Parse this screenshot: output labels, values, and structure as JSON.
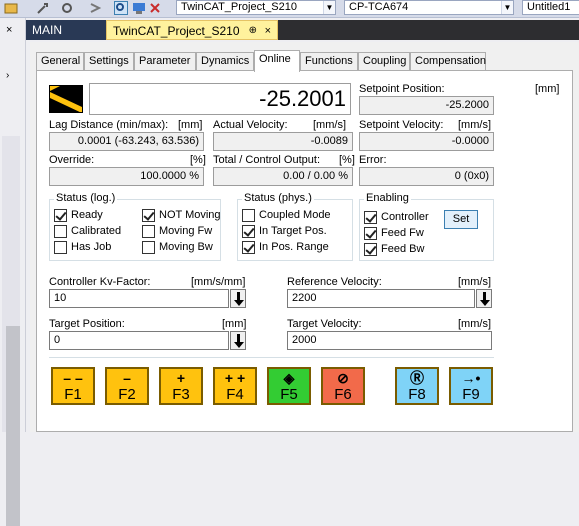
{
  "toolbar": {
    "combo1": "TwinCAT_Project_S210",
    "combo2": "CP-TCA674",
    "combo3": "Untitled1"
  },
  "doc_tabs": {
    "main": "MAIN",
    "active": "TwinCAT_Project_S210",
    "pin": "⊕",
    "close": "×"
  },
  "tabs": [
    "General",
    "Settings",
    "Parameter",
    "Dynamics",
    "Online",
    "Functions",
    "Coupling",
    "Compensation"
  ],
  "online": {
    "actual_position": "-25.2001",
    "setpoint_position_label": "Setpoint Position:",
    "setpoint_position_unit": "[mm]",
    "setpoint_position": "-25.2000",
    "lag_label": "Lag Distance (min/max):",
    "lag_unit": "[mm]",
    "lag_value": "0.0001  (-63.243, 63.536)",
    "actual_velocity_label": "Actual Velocity:",
    "actual_velocity_unit": "[mm/s]",
    "actual_velocity": "-0.0089",
    "setpoint_velocity_label": "Setpoint Velocity:",
    "setpoint_velocity_unit": "[mm/s]",
    "setpoint_velocity": "-0.0000",
    "override_label": "Override:",
    "override_unit": "[%]",
    "override": "100.0000 %",
    "total_output_label": "Total / Control Output:",
    "total_output_unit": "[%]",
    "total_output": "0.00 / 0.00 %",
    "error_label": "Error:",
    "error": "0 (0x0)"
  },
  "status_log": {
    "title": "Status (log.)",
    "items": [
      {
        "label": "Ready",
        "checked": true
      },
      {
        "label": "Calibrated",
        "checked": false
      },
      {
        "label": "Has Job",
        "checked": false
      },
      {
        "label": "NOT Moving",
        "checked": true
      },
      {
        "label": "Moving Fw",
        "checked": false
      },
      {
        "label": "Moving Bw",
        "checked": false
      }
    ]
  },
  "status_phys": {
    "title": "Status (phys.)",
    "items": [
      {
        "label": "Coupled Mode",
        "checked": false
      },
      {
        "label": "In Target Pos.",
        "checked": true
      },
      {
        "label": "In Pos. Range",
        "checked": true
      }
    ]
  },
  "enabling": {
    "title": "Enabling",
    "items": [
      {
        "label": "Controller",
        "checked": true
      },
      {
        "label": "Feed Fw",
        "checked": true
      },
      {
        "label": "Feed Bw",
        "checked": true
      }
    ],
    "set_label": "Set"
  },
  "controls": {
    "kv_label": "Controller Kv-Factor:",
    "kv_unit": "[mm/s/mm]",
    "kv_value": "10",
    "ref_vel_label": "Reference Velocity:",
    "ref_vel_unit": "[mm/s]",
    "ref_vel_value": "2200",
    "target_pos_label": "Target Position:",
    "target_pos_unit": "[mm]",
    "target_pos_value": "0",
    "target_vel_label": "Target Velocity:",
    "target_vel_unit": "[mm/s]",
    "target_vel_value": "2000"
  },
  "fkeys": [
    {
      "symbol": "– –",
      "key": "F1",
      "color": "#ffc20e"
    },
    {
      "symbol": "–",
      "key": "F2",
      "color": "#ffc20e"
    },
    {
      "symbol": "+",
      "key": "F3",
      "color": "#ffc20e"
    },
    {
      "symbol": "+ +",
      "key": "F4",
      "color": "#ffc20e"
    },
    {
      "symbol": "◈",
      "key": "F5",
      "color": "#33cc33"
    },
    {
      "symbol": "⊘",
      "key": "F6",
      "color": "#f26a4a"
    },
    {
      "symbol": "Ⓡ",
      "key": "F8",
      "color": "#7fd3f7"
    },
    {
      "symbol": "→•",
      "key": "F9",
      "color": "#7fd3f7"
    }
  ]
}
